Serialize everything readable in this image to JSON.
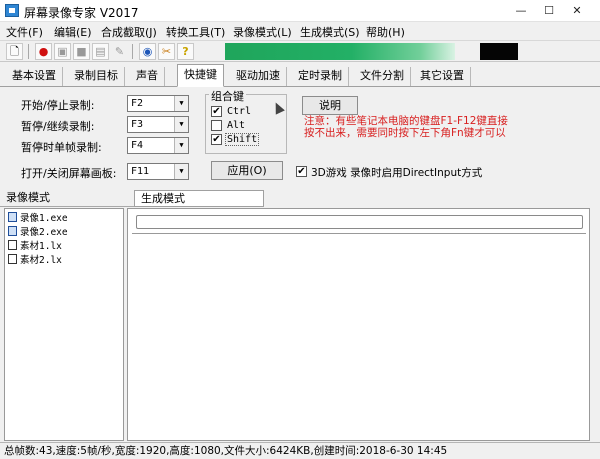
{
  "window": {
    "title": "屏幕录像专家 V2017",
    "min_icon": "minimize-icon",
    "max_icon": "maximize-icon",
    "close_icon": "close-icon"
  },
  "menu": [
    {
      "label": "文件(F)"
    },
    {
      "label": "编辑(E)"
    },
    {
      "label": "合成截取(J)"
    },
    {
      "label": "转换工具(T)"
    },
    {
      "label": "录像模式(L)"
    },
    {
      "label": "生成模式(S)"
    },
    {
      "label": "帮助(H)"
    }
  ],
  "tabs": [
    {
      "label": "基本设置"
    },
    {
      "label": "录制目标"
    },
    {
      "label": "声音"
    },
    {
      "label": "快捷键"
    },
    {
      "label": "驱动加速"
    },
    {
      "label": "定时录制"
    },
    {
      "label": "文件分割"
    },
    {
      "label": "其它设置"
    }
  ],
  "shortcuts": {
    "rows": [
      {
        "label": "开始/停止录制:",
        "value": "F2"
      },
      {
        "label": "暂停/继续录制:",
        "value": "F3"
      },
      {
        "label": "暂停时单帧录制:",
        "value": "F4"
      },
      {
        "label": "打开/关闭屏幕画板:",
        "value": "F11"
      }
    ],
    "group_title": "组合键",
    "modifiers": [
      {
        "label": "Ctrl",
        "checked": true
      },
      {
        "label": "Alt",
        "checked": false
      },
      {
        "label": "Shift",
        "checked": true
      }
    ],
    "explain_button": "说明",
    "note": "注意：有些笔记本电脑的键盘F1-F12键直接按不出来，需要同时按下左下角Fn键才可以",
    "apply_button": "应用(O)",
    "directinput_label": "3D游戏 录像时启用DirectInput方式",
    "directinput_checked": true,
    "check_mark": "✔"
  },
  "left_panel": {
    "header": "录像模式",
    "items": [
      {
        "name": "录像1.exe",
        "type": "exe"
      },
      {
        "name": "录像2.exe",
        "type": "exe"
      },
      {
        "name": "素材1.lx",
        "type": "lx"
      },
      {
        "name": "素材2.lx",
        "type": "lx"
      }
    ]
  },
  "right_panel": {
    "tab": "生成模式"
  },
  "status": "总帧数:43,速度:5帧/秒,宽度:1920,高度:1080,文件大小:6424KB,创建时间:2018-6-30 14:45"
}
